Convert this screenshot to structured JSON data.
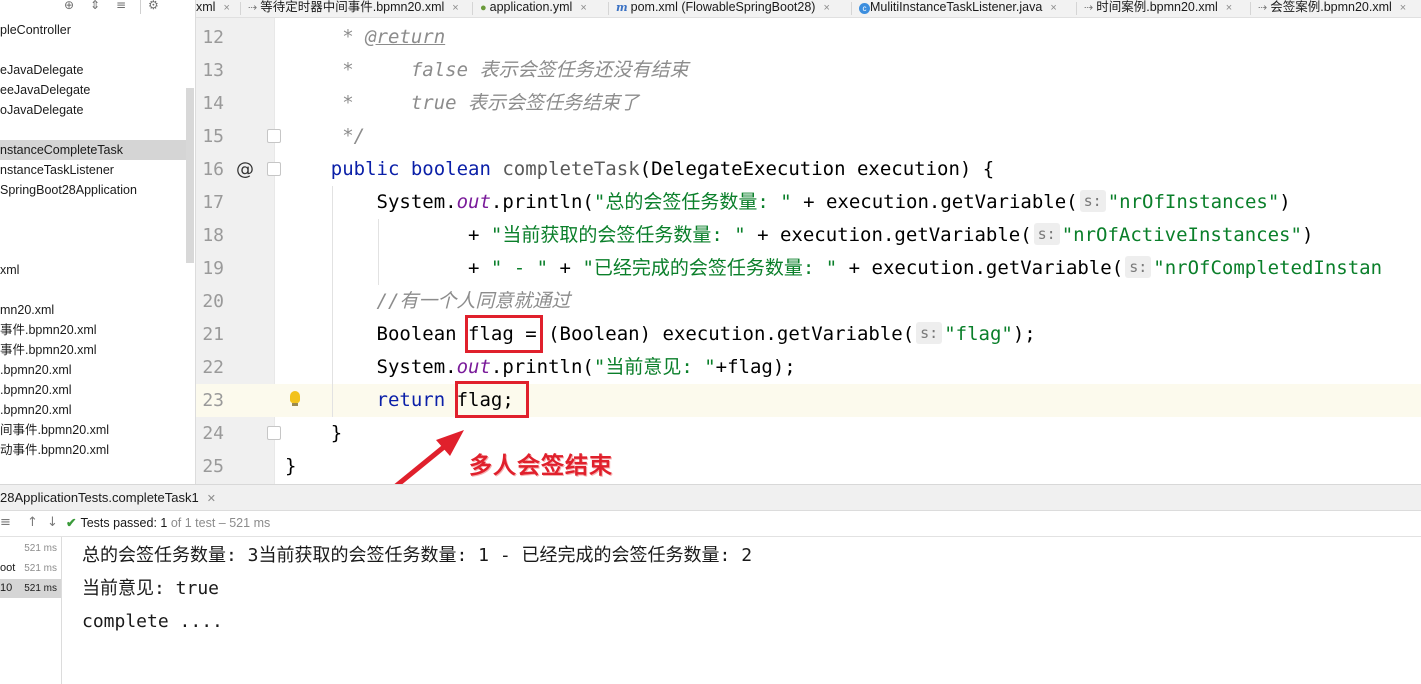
{
  "sidebar": {
    "items": [
      {
        "label": "pleController"
      },
      {
        "label": ""
      },
      {
        "label": "eJavaDelegate"
      },
      {
        "label": "eeJavaDelegate"
      },
      {
        "label": "oJavaDelegate"
      },
      {
        "label": ""
      },
      {
        "label": "nstanceCompleteTask"
      },
      {
        "label": "nstanceTaskListener"
      },
      {
        "label": "SpringBoot28Application"
      },
      {
        "label": ""
      },
      {
        "label": ""
      },
      {
        "label": ""
      },
      {
        "label": "xml"
      },
      {
        "label": ""
      },
      {
        "label": "mn20.xml"
      },
      {
        "label": "事件.bpmn20.xml"
      },
      {
        "label": "事件.bpmn20.xml"
      },
      {
        "label": ".bpmn20.xml"
      },
      {
        "label": ".bpmn20.xml"
      },
      {
        "label": ".bpmn20.xml"
      },
      {
        "label": "间事件.bpmn20.xml"
      },
      {
        "label": "动事件.bpmn20.xml"
      }
    ],
    "selected_index": 6
  },
  "tabs": [
    {
      "icon": "xml-file-icon",
      "label": "xml"
    },
    {
      "icon": "bpmn-file-icon",
      "label": "等待定时器中间事件.bpmn20.xml"
    },
    {
      "icon": "yml-file-icon",
      "label": "application.yml"
    },
    {
      "icon": "maven-pom-icon",
      "label": "pom.xml (FlowableSpringBoot28)"
    },
    {
      "icon": "java-class-icon",
      "label": "MulitiInstanceTaskListener.java"
    },
    {
      "icon": "bpmn-file-icon",
      "label": "时间案例.bpmn20.xml"
    },
    {
      "icon": "bpmn-file-icon",
      "label": "会签案例.bpmn20.xml"
    }
  ],
  "editor": {
    "current_line": 23,
    "lines": [
      {
        "n": "12",
        "tokens": [
          {
            "t": "     ",
            "c": ""
          },
          {
            "t": "* ",
            "c": "cm"
          },
          {
            "t": "@return",
            "c": "cmtag"
          }
        ]
      },
      {
        "n": "13",
        "tokens": [
          {
            "t": "     * ",
            "c": "cm"
          },
          {
            "t": "    false ",
            "c": "cm"
          },
          {
            "t": "表示会签任务还没有结束",
            "c": "cm"
          }
        ]
      },
      {
        "n": "14",
        "tokens": [
          {
            "t": "     * ",
            "c": "cm"
          },
          {
            "t": "    true ",
            "c": "cm"
          },
          {
            "t": "表示会签任务结束了",
            "c": "cm"
          }
        ]
      },
      {
        "n": "15",
        "tokens": [
          {
            "t": "     */",
            "c": "cm"
          }
        ]
      },
      {
        "n": "16",
        "tokens": [
          {
            "t": "    ",
            "c": ""
          },
          {
            "t": "public boolean ",
            "c": "kw"
          },
          {
            "t": "completeTask",
            "c": "fn"
          },
          {
            "t": "(DelegateExecution execution) {",
            "c": ""
          }
        ]
      },
      {
        "n": "17",
        "tokens": [
          {
            "t": "        System.",
            "c": ""
          },
          {
            "t": "out",
            "c": "static-it"
          },
          {
            "t": ".println(",
            "c": ""
          },
          {
            "t": "\"总的会签任务数量: \"",
            "c": "str"
          },
          {
            "t": " + execution.getVariable(",
            "c": ""
          },
          {
            "t": "s:",
            "c": "hint"
          },
          {
            "t": "\"nrOfInstances\"",
            "c": "str"
          },
          {
            "t": ")",
            "c": ""
          }
        ]
      },
      {
        "n": "18",
        "tokens": [
          {
            "t": "                + ",
            "c": ""
          },
          {
            "t": "\"当前获取的会签任务数量: \"",
            "c": "str"
          },
          {
            "t": " + execution.getVariable(",
            "c": ""
          },
          {
            "t": "s:",
            "c": "hint"
          },
          {
            "t": "\"nrOfActiveInstances\"",
            "c": "str"
          },
          {
            "t": ")",
            "c": ""
          }
        ]
      },
      {
        "n": "19",
        "tokens": [
          {
            "t": "                + ",
            "c": ""
          },
          {
            "t": "\" - \"",
            "c": "str"
          },
          {
            "t": " + ",
            "c": ""
          },
          {
            "t": "\"已经完成的会签任务数量: \"",
            "c": "str"
          },
          {
            "t": " + execution.getVariable(",
            "c": ""
          },
          {
            "t": "s:",
            "c": "hint"
          },
          {
            "t": "\"nrOfCompletedInstan",
            "c": "str"
          }
        ]
      },
      {
        "n": "20",
        "tokens": [
          {
            "t": "        ",
            "c": ""
          },
          {
            "t": "//有一个人同意就通过",
            "c": "cm"
          }
        ]
      },
      {
        "n": "21",
        "tokens": [
          {
            "t": "        Boolean flag = (Boolean) execution.getVariable(",
            "c": ""
          },
          {
            "t": "s:",
            "c": "hint"
          },
          {
            "t": "\"flag\"",
            "c": "str"
          },
          {
            "t": ");",
            "c": ""
          }
        ]
      },
      {
        "n": "22",
        "tokens": [
          {
            "t": "        System.",
            "c": ""
          },
          {
            "t": "out",
            "c": "static-it"
          },
          {
            "t": ".println(",
            "c": ""
          },
          {
            "t": "\"当前意见: \"",
            "c": "str"
          },
          {
            "t": "+flag);",
            "c": ""
          }
        ]
      },
      {
        "n": "23",
        "tokens": [
          {
            "t": "        ",
            "c": ""
          },
          {
            "t": "return ",
            "c": "kw"
          },
          {
            "t": "flag;",
            "c": ""
          }
        ]
      },
      {
        "n": "24",
        "tokens": [
          {
            "t": "    }",
            "c": ""
          }
        ]
      },
      {
        "n": "25",
        "tokens": [
          {
            "t": "}",
            "c": ""
          }
        ]
      }
    ]
  },
  "run": {
    "title": "28ApplicationTests.completeTask1",
    "status_label": "Tests passed:",
    "passed": "1",
    "of_text": "of 1 test",
    "duration": "521 ms",
    "tree": [
      {
        "label": "",
        "ms": "521 ms"
      },
      {
        "label": "oot",
        "ms": "521 ms"
      },
      {
        "label": "10",
        "ms": "521 ms"
      }
    ],
    "console": [
      "总的会签任务数量: 3当前获取的会签任务数量: 1 - 已经完成的会签任务数量: 2",
      "当前意见: true",
      "complete ...."
    ]
  },
  "annotation": {
    "text": "多人会签结束",
    "color": "#e0202c"
  }
}
